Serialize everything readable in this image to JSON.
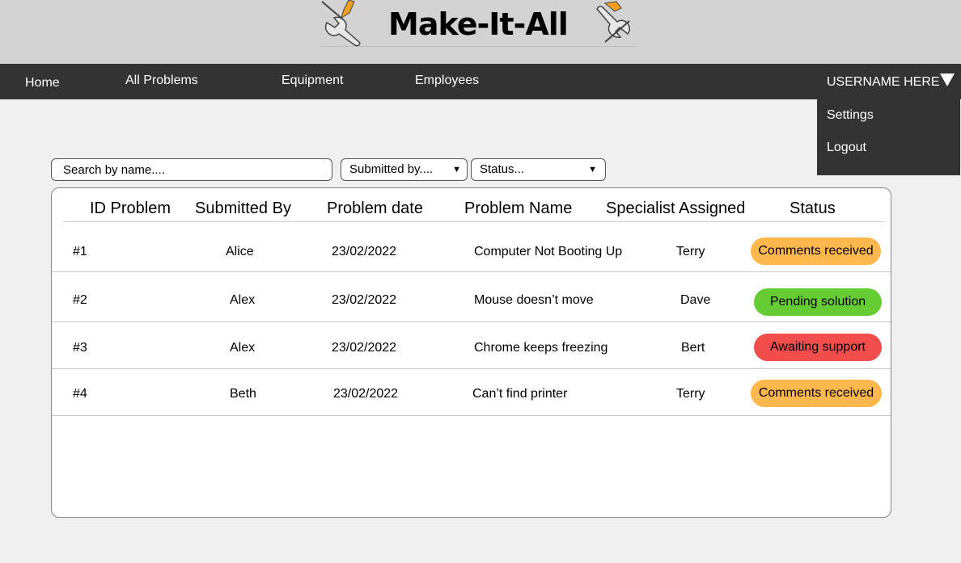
{
  "header": {
    "logo_text": "Make-It-All"
  },
  "nav": {
    "items": [
      {
        "label": "Home"
      },
      {
        "label": "All Problems"
      },
      {
        "label": "Equipment"
      },
      {
        "label": "Employees"
      }
    ],
    "user": {
      "name": "USERNAME HERE",
      "menu": [
        {
          "label": "Settings"
        },
        {
          "label": "Logout"
        }
      ]
    }
  },
  "filters": {
    "search_placeholder": "Search by name....",
    "submitted_by": "Submitted by....",
    "status": "Status...",
    "arrow": "▼"
  },
  "table": {
    "columns": [
      "ID Problem",
      "Submitted By",
      "Problem date",
      "Problem Name",
      "Specialist Assigned",
      "Status"
    ],
    "rows": [
      {
        "id": "#1",
        "submitted_by": "Alice",
        "date": "23/02/2022",
        "name": "Computer Not Booting Up",
        "specialist": "Terry",
        "status": "Comments received",
        "status_color": "#ffb84d"
      },
      {
        "id": "#2",
        "submitted_by": "Alex",
        "date": "23/02/2022",
        "name": "Mouse doesn’t move",
        "specialist": "Dave",
        "status": "Pending solution",
        "status_color": "#66cc33"
      },
      {
        "id": "#3",
        "submitted_by": "Alex",
        "date": "23/02/2022",
        "name": "Chrome keeps freezing",
        "specialist": "Bert",
        "status": "Awaiting support",
        "status_color": "#f24d4d"
      },
      {
        "id": "#4",
        "submitted_by": "Beth",
        "date": "23/02/2022",
        "name": "Can’t find printer",
        "specialist": "Terry",
        "status": "Comments received",
        "status_color": "#ffb84d"
      }
    ]
  },
  "colors": {
    "nav_bg": "#333333",
    "header_bg": "#d3d3d3",
    "page_bg": "#f0f0f0"
  }
}
